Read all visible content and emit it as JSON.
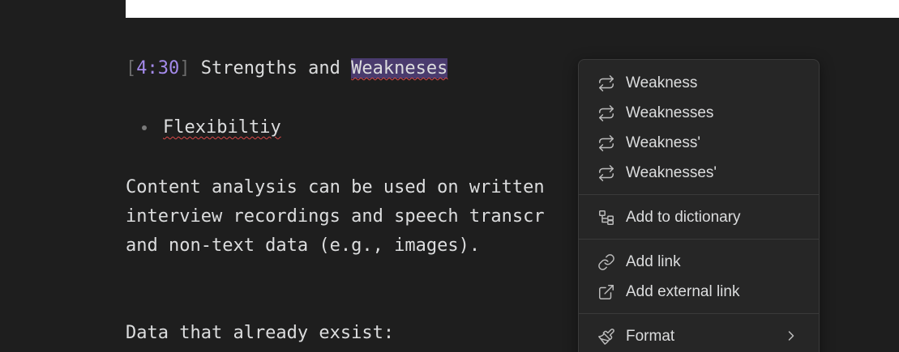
{
  "editor": {
    "timestamp_open": "[",
    "timestamp_time": "4:30",
    "timestamp_close": "]",
    "heading_prefix": " Strengths and ",
    "heading_selected": "Weakneses",
    "bullet_item": "Flexibiltiy",
    "para_line1": "Content analysis can be used on written",
    "para_line2": "interview recordings and speech transcr",
    "para_line3": "and non-text data (e.g., images).",
    "data_line": "Data that already exsist:"
  },
  "context_menu": {
    "suggestions": [
      {
        "label": "Weakness",
        "icon": "replace-icon"
      },
      {
        "label": "Weaknesses",
        "icon": "replace-icon"
      },
      {
        "label": "Weakness'",
        "icon": "replace-icon"
      },
      {
        "label": "Weaknesses'",
        "icon": "replace-icon"
      }
    ],
    "add_dictionary": "Add to dictionary",
    "add_link": "Add link",
    "add_external_link": "Add external link",
    "format": "Format"
  },
  "colors": {
    "background": "#1e1e1e",
    "text": "#dcddde",
    "accent_timestamp": "#a48aeb",
    "selection": "#4a3b6e",
    "spellcheck": "#d94848",
    "menu_bg": "#262626"
  }
}
